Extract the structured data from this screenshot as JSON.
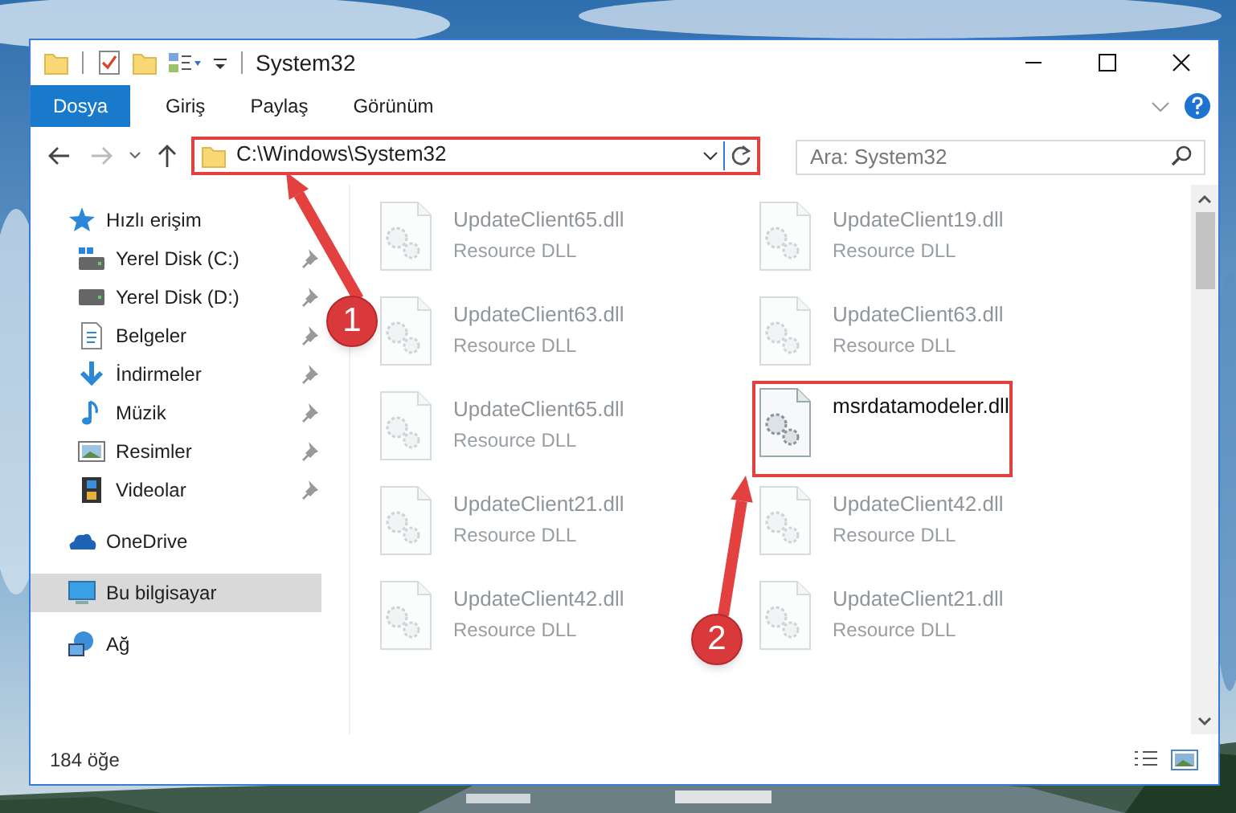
{
  "window": {
    "title": "System32"
  },
  "ribbon_tabs": [
    {
      "label": "Dosya",
      "kind": "file"
    },
    {
      "label": "Giriş",
      "kind": "tab"
    },
    {
      "label": "Paylaş",
      "kind": "tab"
    },
    {
      "label": "Görünüm",
      "kind": "tab"
    }
  ],
  "address_bar": {
    "path": "C:\\Windows\\System32"
  },
  "search": {
    "placeholder": "Ara: System32"
  },
  "sidebar": {
    "items": [
      {
        "label": "Hızlı erişim",
        "selected": false,
        "children": [
          {
            "label": "Yerel Disk (C:)",
            "pinned": true,
            "selected": false
          },
          {
            "label": "Yerel Disk (D:)",
            "pinned": true,
            "selected": false
          },
          {
            "label": "Belgeler",
            "pinned": true,
            "selected": false
          },
          {
            "label": "İndirmeler",
            "pinned": true,
            "selected": false
          },
          {
            "label": "Müzik",
            "pinned": true,
            "selected": false
          },
          {
            "label": "Resimler",
            "pinned": true,
            "selected": false
          },
          {
            "label": "Videolar",
            "pinned": true,
            "selected": false
          }
        ]
      },
      {
        "label": "OneDrive",
        "selected": false
      },
      {
        "label": "Bu bilgisayar",
        "selected": true
      },
      {
        "label": "Ağ",
        "selected": false
      }
    ]
  },
  "files": [
    {
      "name": "UpdateClient65.dll",
      "type": "Resource DLL",
      "dimmed": true,
      "highlighted": false
    },
    {
      "name": "UpdateClient19.dll",
      "type": "Resource DLL",
      "dimmed": true,
      "highlighted": false
    },
    {
      "name": "UpdateClient63.dll",
      "type": "Resource DLL",
      "dimmed": true,
      "highlighted": false
    },
    {
      "name": "UpdateClient63.dll",
      "type": "Resource DLL",
      "dimmed": true,
      "highlighted": false
    },
    {
      "name": "UpdateClient65.dll",
      "type": "Resource DLL",
      "dimmed": true,
      "highlighted": false
    },
    {
      "name": "msrdatamodeler.dll",
      "dimmed": false,
      "highlighted": true
    },
    {
      "name": "UpdateClient21.dll",
      "type": "Resource DLL",
      "dimmed": true,
      "highlighted": false
    },
    {
      "name": "UpdateClient42.dll",
      "type": "Resource DLL",
      "dimmed": true,
      "highlighted": false
    },
    {
      "name": "UpdateClient42.dll",
      "type": "Resource DLL",
      "dimmed": true,
      "highlighted": false
    },
    {
      "name": "UpdateClient21.dll",
      "type": "Resource DLL",
      "dimmed": true,
      "highlighted": false
    }
  ],
  "status_bar": {
    "count": "184 öğe"
  },
  "annotations": [
    {
      "label": "1"
    },
    {
      "label": "2"
    }
  ]
}
